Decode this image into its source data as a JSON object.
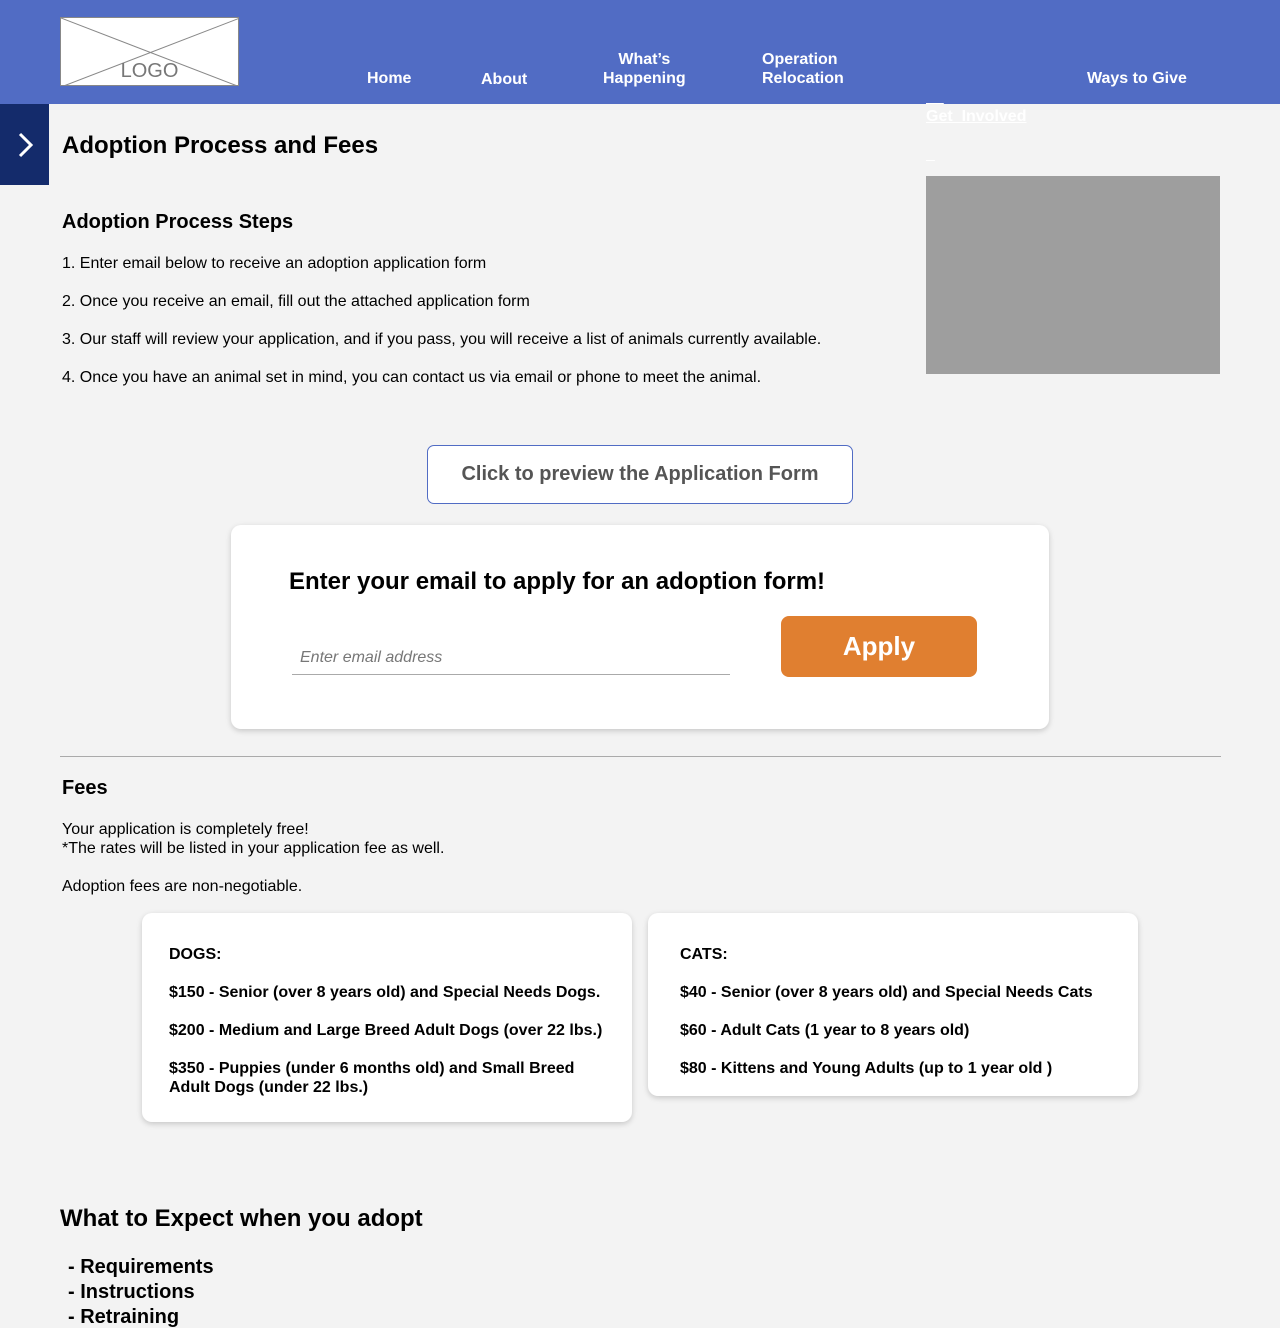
{
  "header": {
    "logo_text": "LOGO",
    "nav": [
      {
        "line1": "Home",
        "line2": ""
      },
      {
        "line1": "About",
        "line2": ""
      },
      {
        "line1": "What’s",
        "line2": "Happening"
      },
      {
        "line1": "Operation",
        "line2": "Relocation"
      },
      {
        "line1": "Get  Involved",
        "line2": ""
      },
      {
        "line1": "Ways to Give",
        "line2": ""
      }
    ],
    "active_nav": "Get  Involved"
  },
  "page_title": "Adoption Process and Fees",
  "steps": {
    "title": "Adoption Process Steps",
    "items": [
      "1. Enter email below to receive an adoption application form",
      "2. Once you receive an email, fill out the attached application form",
      "3. Our staff will review your application, and if you pass, you will receive a list of animals currently available.",
      "4. Once you have an animal set in mind, you can contact us via email or phone to meet the animal."
    ]
  },
  "preview_button_label": "Click to preview the Application Form",
  "email_card": {
    "title": "Enter your email to apply for an adoption form!",
    "input_placeholder": "Enter email address",
    "input_value": "",
    "apply_label": "Apply"
  },
  "fees": {
    "title": "Fees",
    "line1": "Your application is completely free!",
    "line2": "*The rates will be listed in your application fee as well.",
    "line3": "Adoption fees are non-negotiable.",
    "dogs": {
      "heading": "DOGS:",
      "items": [
        "$150 - Senior (over 8 years old) and Special Needs Dogs.",
        "$200 - Medium and Large Breed Adult Dogs (over 22 lbs.)",
        "$350 - Puppies (under 6 months old) and Small Breed Adult Dogs (under 22 lbs.)"
      ]
    },
    "cats": {
      "heading": "CATS:",
      "items": [
        "$40 - Senior (over 8 years old) and Special Needs Cats",
        "$60 - Adult Cats (1 year to 8 years old)",
        "$80 - Kittens and Young Adults (up to 1 year old )"
      ]
    }
  },
  "expect": {
    "title": "What to Expect when you adopt",
    "items": [
      "- Requirements",
      "- Instructions",
      "- Retraining"
    ]
  },
  "colors": {
    "header_bg": "#516cc4",
    "side_toggle_bg": "#142b6b",
    "apply_button": "#e07f30",
    "image_placeholder": "#9e9e9e",
    "page_bg": "#f3f3f3"
  },
  "icons": {
    "side_toggle": "chevron-right-icon"
  }
}
